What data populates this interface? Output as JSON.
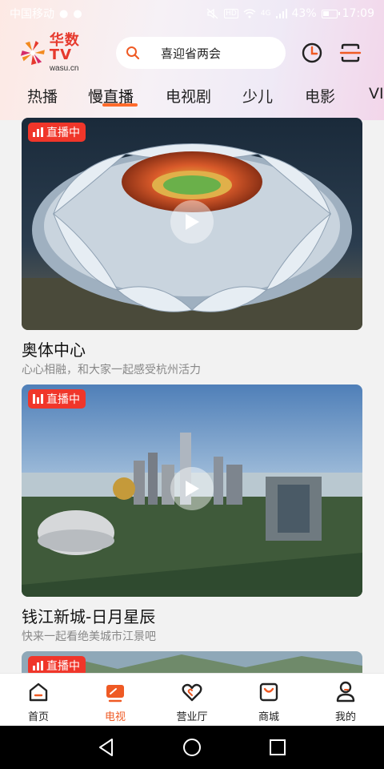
{
  "status_bar": {
    "carrier": "中国移动",
    "battery_percent": "43%",
    "time": "17:09",
    "network": "4G",
    "hd": "HD"
  },
  "header": {
    "logo_brand": "华数TV",
    "logo_url": "wasu.cn",
    "search_text": "喜迎省两会"
  },
  "tabs": [
    {
      "label": "热播",
      "active": false
    },
    {
      "label": "慢直播",
      "active": true
    },
    {
      "label": "电视剧",
      "active": false
    },
    {
      "label": "少儿",
      "active": false
    },
    {
      "label": "电影",
      "active": false
    },
    {
      "label": "VI",
      "active": false
    }
  ],
  "cards": [
    {
      "badge": "直播中",
      "title": "奥体中心",
      "subtitle": "心心相融，和大家一起感受杭州活力"
    },
    {
      "badge": "直播中",
      "title": "钱江新城-日月星辰",
      "subtitle": "快来一起看绝美城市江景吧"
    },
    {
      "badge": "直播中"
    }
  ],
  "bottom_nav": [
    {
      "label": "首页",
      "icon": "home-icon",
      "active": false
    },
    {
      "label": "电视",
      "icon": "tv-icon",
      "active": true
    },
    {
      "label": "营业厅",
      "icon": "heart-icon",
      "active": false
    },
    {
      "label": "商城",
      "icon": "shopping-bag-icon",
      "active": false
    },
    {
      "label": "我的",
      "icon": "profile-icon",
      "active": false
    }
  ],
  "colors": {
    "accent": "#ef5a24",
    "live_badge": "#f0362a",
    "brand_red": "#e6392d"
  }
}
